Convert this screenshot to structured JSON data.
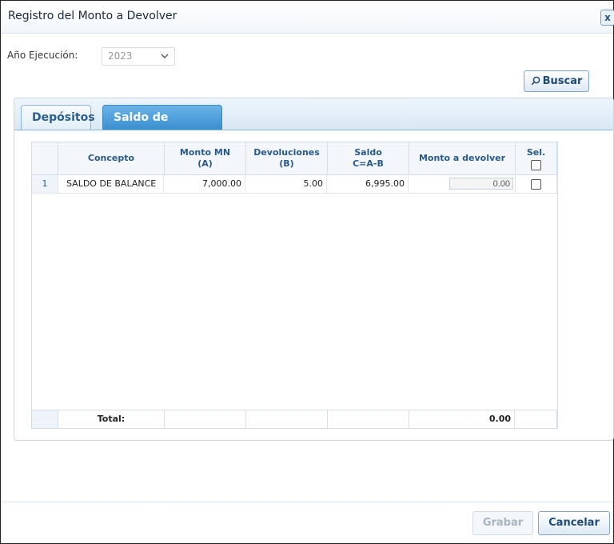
{
  "dialog": {
    "title": "Registro del Monto a Devolver",
    "close_icon": "close-icon"
  },
  "filters": {
    "year_label": "Año Ejecución:",
    "year_value": "2023"
  },
  "actions": {
    "search_label": "Buscar",
    "save_label": "Grabar",
    "cancel_label": "Cancelar"
  },
  "tabs": [
    {
      "label": "Depósitos",
      "active": false
    },
    {
      "label": "Saldo de Balance",
      "active": true
    }
  ],
  "grid": {
    "columns": [
      {
        "line1": "",
        "line2": ""
      },
      {
        "line1": "Concepto",
        "line2": ""
      },
      {
        "line1": "Monto MN",
        "line2": "(A)"
      },
      {
        "line1": "Devoluciones",
        "line2": "(B)"
      },
      {
        "line1": "Saldo",
        "line2": "C=A-B"
      },
      {
        "line1": "Monto a devolver",
        "line2": ""
      },
      {
        "line1": "Sel.",
        "line2": ""
      }
    ],
    "rows": [
      {
        "num": "1",
        "concepto": "SALDO DE BALANCE",
        "monto": "7,000.00",
        "devoluciones": "5.00",
        "saldo": "6,995.00",
        "monto_devolver": "0.00",
        "selected": false
      }
    ],
    "footer": {
      "label": "Total:",
      "total": "0.00"
    }
  },
  "colors": {
    "accent": "#3a8fd0",
    "link": "#2a5a8a"
  }
}
